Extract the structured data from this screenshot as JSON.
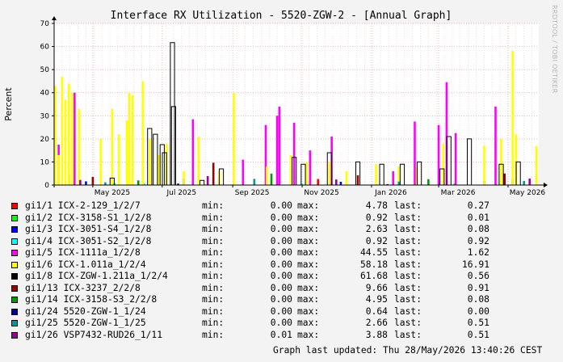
{
  "title": "Interface RX Utilization - 5520-ZGW-2 - [Annual Graph]",
  "watermark": "RRDTOOL / TOBI OETIKER",
  "updated_text": "Graph last updated: Thu 28/May/2026 13:40:26 CEST",
  "legend_labels": {
    "min": "min:",
    "max": "max:",
    "last": "last:"
  },
  "chart_data": {
    "type": "area",
    "title": "Interface RX Utilization - 5520-ZGW-2 - [Annual Graph]",
    "xlabel": "",
    "ylabel": "Percent",
    "ylim": [
      0,
      70
    ],
    "yticks": [
      0,
      10,
      20,
      30,
      40,
      50,
      60,
      70
    ],
    "xlim": [
      "2025-03-28",
      "2026-05-28"
    ],
    "xticks": [
      {
        "label": "May 2025",
        "date": "2025-05-01"
      },
      {
        "label": "Jul 2025",
        "date": "2025-07-01"
      },
      {
        "label": "Sep 2025",
        "date": "2025-09-01"
      },
      {
        "label": "Nov 2025",
        "date": "2025-11-01"
      },
      {
        "label": "Jan 2026",
        "date": "2026-01-01"
      },
      {
        "label": "Mar 2026",
        "date": "2026-03-01"
      },
      {
        "label": "May 2026",
        "date": "2026-05-01"
      }
    ],
    "grid": true,
    "legend_position": "bottom",
    "series": [
      {
        "name": "gi1/1 ICX-2-129_1/2/7",
        "color": "#ff0000",
        "style": "area",
        "min": "0.00",
        "max": "4.78",
        "last": "0.27",
        "points": [
          [
            "2025-04-10",
            4.78
          ],
          [
            "2025-06-05",
            2.1
          ],
          [
            "2025-08-20",
            3.2
          ],
          [
            "2025-11-15",
            2.6
          ],
          [
            "2026-02-10",
            3.0
          ],
          [
            "2026-05-05",
            2.4
          ]
        ]
      },
      {
        "name": "gi1/2 ICX-3158-S1_1/2/8",
        "color": "#00ff00",
        "style": "area",
        "min": "0.00",
        "max": "0.92",
        "last": "0.01",
        "points": [
          [
            "2025-05-20",
            0.92
          ],
          [
            "2025-10-10",
            0.6
          ],
          [
            "2026-03-15",
            0.8
          ]
        ]
      },
      {
        "name": "gi1/3 ICX-3051-S4_1/2/8",
        "color": "#0000ff",
        "style": "area",
        "min": "0.00",
        "max": "2.63",
        "last": "0.08",
        "points": [
          [
            "2025-04-25",
            1.6
          ],
          [
            "2025-07-20",
            2.63
          ],
          [
            "2025-12-05",
            1.4
          ],
          [
            "2026-04-10",
            1.9
          ]
        ]
      },
      {
        "name": "gi1/4 ICX-3051-S2_1/2/8",
        "color": "#00ffff",
        "style": "area",
        "min": "0.00",
        "max": "0.92",
        "last": "0.92",
        "points": [
          [
            "2025-06-15",
            0.9
          ],
          [
            "2025-11-01",
            0.7
          ],
          [
            "2026-04-20",
            0.92
          ]
        ]
      },
      {
        "name": "gi1/5 ICX-1111a_1/2/8",
        "color": "#ff00ff",
        "style": "area",
        "min": "0.00",
        "max": "44.55",
        "last": "1.62",
        "points": [
          [
            "2025-04-01",
            17.5
          ],
          [
            "2025-04-15",
            40.0
          ],
          [
            "2025-07-28",
            28.5
          ],
          [
            "2025-09-10",
            11.0
          ],
          [
            "2025-09-30",
            26.0
          ],
          [
            "2025-10-10",
            30.0
          ],
          [
            "2025-10-12",
            34.0
          ],
          [
            "2025-10-25",
            27.0
          ],
          [
            "2025-11-08",
            15.0
          ],
          [
            "2025-11-27",
            21.0
          ],
          [
            "2026-01-20",
            6.0
          ],
          [
            "2026-02-08",
            27.5
          ],
          [
            "2026-03-01",
            26.0
          ],
          [
            "2026-03-08",
            44.55
          ],
          [
            "2026-03-16",
            22.5
          ],
          [
            "2026-04-20",
            34.0
          ]
        ]
      },
      {
        "name": "gi1/6 ICX-1.011a_1/2/4",
        "color": "#ffff00",
        "style": "area",
        "min": "0.00",
        "max": "58.18",
        "last": "16.91",
        "points": [
          [
            "2025-03-29",
            43.0
          ],
          [
            "2025-04-01",
            13.0
          ],
          [
            "2025-04-04",
            47.0
          ],
          [
            "2025-04-07",
            37.0
          ],
          [
            "2025-04-10",
            44.0
          ],
          [
            "2025-04-13",
            40.0
          ],
          [
            "2025-04-19",
            33.0
          ],
          [
            "2025-05-08",
            20.0
          ],
          [
            "2025-05-18",
            33.0
          ],
          [
            "2025-05-24",
            22.0
          ],
          [
            "2025-05-31",
            28.0
          ],
          [
            "2025-06-02",
            40.0
          ],
          [
            "2025-06-05",
            39.0
          ],
          [
            "2025-06-14",
            45.0
          ],
          [
            "2025-06-20",
            20.0
          ],
          [
            "2025-06-28",
            13.0
          ],
          [
            "2025-07-05",
            18.0
          ],
          [
            "2025-07-20",
            6.0
          ],
          [
            "2025-08-02",
            21.0
          ],
          [
            "2025-08-20",
            6.0
          ],
          [
            "2025-09-02",
            40.0
          ],
          [
            "2025-10-01",
            8.0
          ],
          [
            "2025-10-22",
            13.0
          ],
          [
            "2025-11-05",
            10.0
          ],
          [
            "2025-11-25",
            10.0
          ],
          [
            "2025-12-10",
            6.0
          ],
          [
            "2026-01-05",
            9.0
          ],
          [
            "2026-01-25",
            8.0
          ],
          [
            "2026-02-10",
            8.0
          ],
          [
            "2026-03-05",
            18.0
          ],
          [
            "2026-04-10",
            17.0
          ],
          [
            "2026-04-25",
            20.0
          ],
          [
            "2026-05-05",
            58.18
          ],
          [
            "2026-05-08",
            22.0
          ],
          [
            "2026-05-26",
            16.91
          ]
        ]
      },
      {
        "name": "gi1/8 ICX-ZGW-1.211a_1/2/4",
        "color": "#000000",
        "style": "line",
        "min": "0.00",
        "max": "61.68",
        "last": "0.56",
        "points": [
          [
            "2025-05-18",
            3.0
          ],
          [
            "2025-06-20",
            24.5
          ],
          [
            "2025-06-25",
            22.0
          ],
          [
            "2025-07-01",
            17.5
          ],
          [
            "2025-07-03",
            14.0
          ],
          [
            "2025-07-10",
            61.68
          ],
          [
            "2025-07-11",
            34.0
          ],
          [
            "2025-08-05",
            2.0
          ],
          [
            "2025-08-22",
            7.0
          ],
          [
            "2025-10-25",
            12.0
          ],
          [
            "2025-11-02",
            9.0
          ],
          [
            "2025-11-25",
            14.0
          ],
          [
            "2025-12-20",
            10.0
          ],
          [
            "2026-01-10",
            9.0
          ],
          [
            "2026-01-28",
            9.0
          ],
          [
            "2026-02-12",
            10.0
          ],
          [
            "2026-03-04",
            7.0
          ],
          [
            "2026-03-10",
            21.0
          ],
          [
            "2026-03-28",
            20.0
          ],
          [
            "2026-04-25",
            9.0
          ],
          [
            "2026-05-10",
            10.0
          ]
        ]
      },
      {
        "name": "gi1/13 ICX-3237_2/2/8",
        "color": "#990000",
        "style": "area",
        "min": "0.00",
        "max": "9.66",
        "last": "0.91",
        "points": [
          [
            "2025-05-01",
            3.5
          ],
          [
            "2025-08-15",
            9.66
          ],
          [
            "2025-12-20",
            4.2
          ],
          [
            "2026-04-28",
            5.0
          ]
        ]
      },
      {
        "name": "gi1/14 ICX-3158-S3_2/2/8",
        "color": "#009900",
        "style": "area",
        "min": "0.00",
        "max": "4.95",
        "last": "0.08",
        "points": [
          [
            "2025-06-10",
            2.0
          ],
          [
            "2025-10-05",
            4.95
          ],
          [
            "2026-02-20",
            2.5
          ]
        ]
      },
      {
        "name": "gi1/24 5520-ZGW-1_1/24",
        "color": "#000099",
        "style": "area",
        "min": "0.00",
        "max": "0.64",
        "last": "0.00",
        "points": [
          [
            "2025-07-15",
            0.64
          ],
          [
            "2026-01-15",
            0.4
          ]
        ]
      },
      {
        "name": "gi1/25 5520-ZGW-1_1/25",
        "color": "#009999",
        "style": "area",
        "min": "0.00",
        "max": "2.66",
        "last": "0.51",
        "points": [
          [
            "2025-05-12",
            1.2
          ],
          [
            "2025-09-20",
            2.66
          ],
          [
            "2026-01-25",
            1.5
          ],
          [
            "2026-05-15",
            1.8
          ]
        ]
      },
      {
        "name": "gi1/26 VSP7432-RUD26_1/11",
        "color": "#990099",
        "style": "area",
        "min": "0.01",
        "max": "3.88",
        "last": "0.51",
        "points": [
          [
            "2025-04-20",
            2.2
          ],
          [
            "2025-08-10",
            3.88
          ],
          [
            "2025-12-01",
            2.4
          ],
          [
            "2026-05-20",
            2.8
          ]
        ]
      }
    ]
  }
}
